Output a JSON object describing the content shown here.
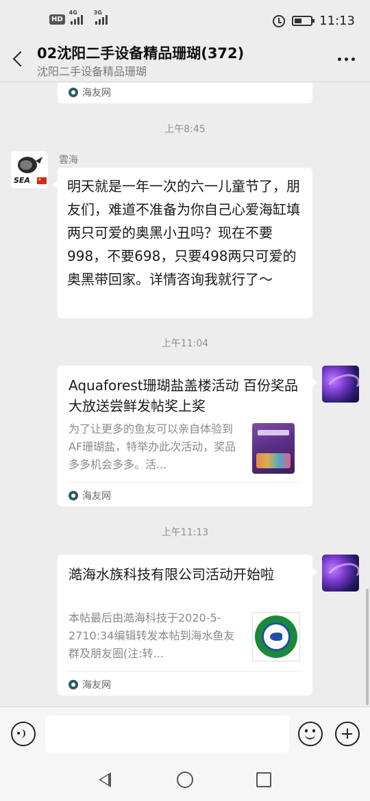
{
  "status_bar": {
    "hd_label": "HD",
    "sim1_net": "4G",
    "sim2_net": "3G",
    "time": "11:13"
  },
  "header": {
    "title": "02沈阳二手设备精品珊瑚(372)",
    "subtitle": "沈阳二手设备精品珊瑚"
  },
  "messages": {
    "prev_card_source": "海友网",
    "time1": "上午8:45",
    "msg1": {
      "sender": "雲海",
      "avatar_text": "SEA",
      "text": "明天就是一年一次的六一儿童节了，朋友们，难道不准备为你自己心爱海缸填两只可爱的奥黑小丑吗？现在不要998，不要698，只要498两只可爱的奥黑带回家。详情咨询我就行了～"
    },
    "time2": "上午11:04",
    "card1": {
      "title": "Aquaforest珊瑚盐盖楼活动 百份奖品大放送尝鲜发帖奖上奖",
      "desc": "为了让更多的鱼友可以亲自体验到AF珊瑚盐，特举办此次活动，奖品多多机会多多。活...",
      "source": "海友网"
    },
    "time3": "上午11:13",
    "card2": {
      "title": "澔海水族科技有限公司活动开始啦",
      "desc": "本帖最后由澔海科技于2020-5-2710:34编辑转发本帖到海水鱼友群及朋友圈(注:转...",
      "source": "海友网"
    }
  },
  "input": {
    "value": "",
    "placeholder": ""
  },
  "colors": {
    "background": "#ededed",
    "bubble": "#ffffff",
    "source_icon": "#2d5a66"
  }
}
